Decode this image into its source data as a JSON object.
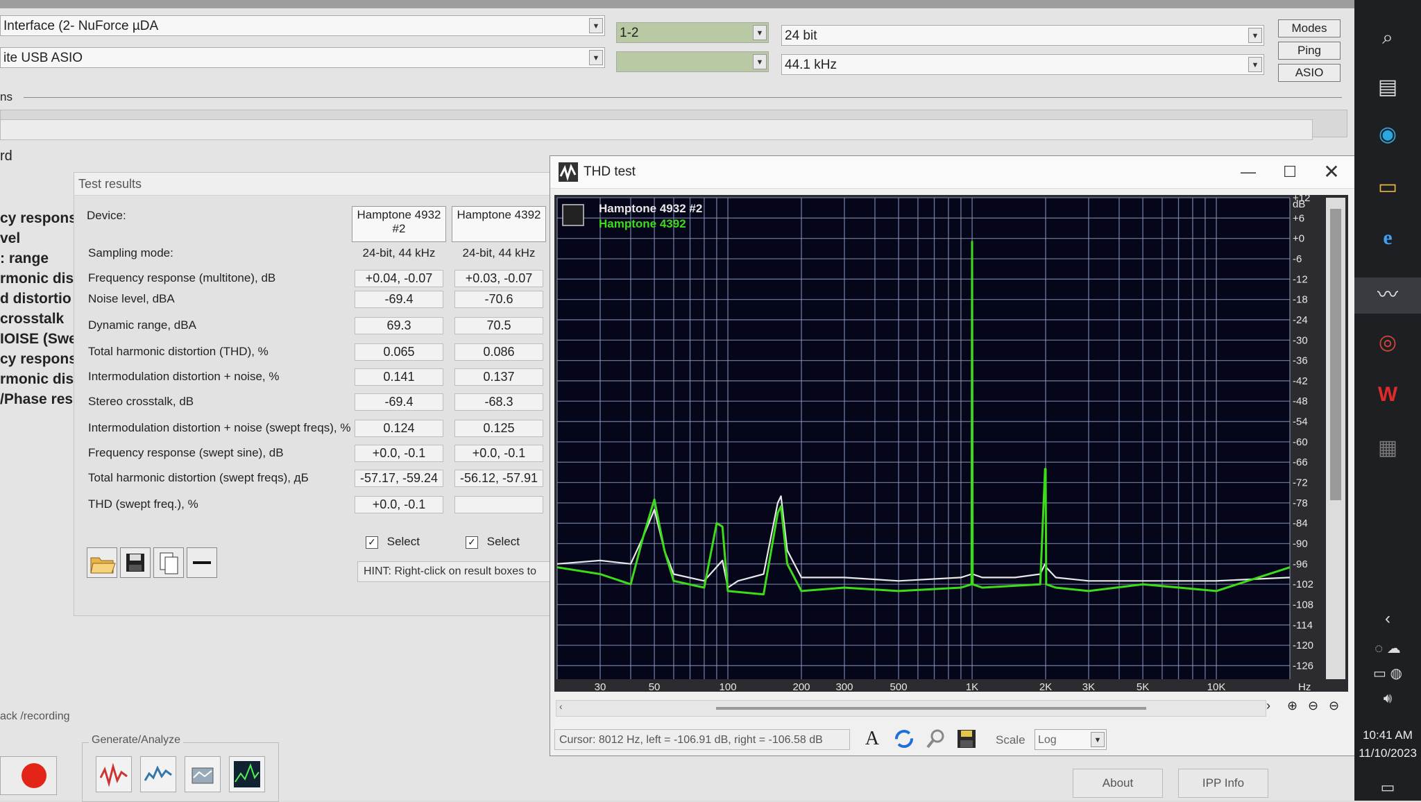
{
  "top": {
    "device1": "Interface (2- NuForce µDA",
    "device2": "ite USB ASIO",
    "channels1": "1-2",
    "channels2": "",
    "bits": "24 bit",
    "rate": "44.1 kHz",
    "modes_label": "Modes",
    "ping_label": "Ping",
    "asio_label": "ASIO",
    "section_label": "ns",
    "rd_label": "rd"
  },
  "left_list": [
    "cy respons",
    "vel",
    ": range",
    "rmonic dist",
    "d distortio",
    "crosstalk",
    "IOISE (Swe",
    "cy respons",
    "rmonic dist",
    "/Phase res"
  ],
  "bottom": {
    "playback_label": "ack /recording",
    "generate_label": "Generate/Analyze",
    "about_label": "About",
    "ipp_label": "IPP Info"
  },
  "test_results": {
    "title": "Test results",
    "device_label": "Device:",
    "device_a": "Hamptone 4932 #2",
    "device_b": "Hamptone 4392",
    "rows": [
      {
        "label": "Sampling mode:",
        "a": "24-bit, 44 kHz",
        "b": "24-bit, 44 kHz"
      },
      {
        "label": "Frequency response (multitone), dB",
        "a": "+0.04, -0.07",
        "b": "+0.03, -0.07"
      },
      {
        "label": "Noise level, dBA",
        "a": "-69.4",
        "b": "-70.6"
      },
      {
        "label": "Dynamic range, dBA",
        "a": "69.3",
        "b": "70.5"
      },
      {
        "label": "Total harmonic distortion (THD), %",
        "a": "0.065",
        "b": "0.086"
      },
      {
        "label": "Intermodulation distortion + noise, %",
        "a": "0.141",
        "b": "0.137"
      },
      {
        "label": "Stereo crosstalk, dB",
        "a": "-69.4",
        "b": "-68.3"
      },
      {
        "label": "Intermodulation distortion + noise (swept freqs), %",
        "a": "0.124",
        "b": "0.125"
      },
      {
        "label": "Frequency response (swept sine), dB",
        "a": "+0.0, -0.1",
        "b": "+0.0, -0.1"
      },
      {
        "label": "Total harmonic distortion (swept freqs), дБ",
        "a": "-57.17, -59.24",
        "b": "-56.12, -57.91"
      },
      {
        "label": "THD (swept freq.), %",
        "a": "+0.0, -0.1",
        "b": ""
      }
    ],
    "select_label": "Select",
    "hint": "HINT: Right-click on result boxes to"
  },
  "thd": {
    "title": "THD test",
    "legend": [
      {
        "name": "Hamptone 4932 #2",
        "color": "#ffffff"
      },
      {
        "name": "Hamptone 4392",
        "color": "#3ddc1a"
      }
    ],
    "cursor_text": "Cursor: 8012 Hz, left = -106.91 dB, right = -106.58 dB",
    "scale_label": "Scale",
    "scale_value": "Log"
  },
  "chart_data": {
    "type": "line",
    "title": "THD test",
    "xlabel": "Hz",
    "ylabel": "dB",
    "x_scale": "log",
    "xlim": [
      20,
      20000
    ],
    "ylim": [
      -130,
      12
    ],
    "x_ticks": [
      {
        "v": 30,
        "t": "30"
      },
      {
        "v": 50,
        "t": "50"
      },
      {
        "v": 100,
        "t": "100"
      },
      {
        "v": 200,
        "t": "200"
      },
      {
        "v": 300,
        "t": "300"
      },
      {
        "v": 500,
        "t": "500"
      },
      {
        "v": 1000,
        "t": "1K"
      },
      {
        "v": 2000,
        "t": "2K"
      },
      {
        "v": 3000,
        "t": "3K"
      },
      {
        "v": 5000,
        "t": "5K"
      },
      {
        "v": 10000,
        "t": "10K"
      }
    ],
    "y_ticks": [
      "+12",
      "+6",
      "+0",
      "-6",
      "-12",
      "-18",
      "-24",
      "-30",
      "-36",
      "-42",
      "-48",
      "-54",
      "-60",
      "-66",
      "-72",
      "-78",
      "-84",
      "-90",
      "-96",
      "-102",
      "-108",
      "-114",
      "-120",
      "-126"
    ],
    "grid": true,
    "series": [
      {
        "name": "Hamptone 4932 #2",
        "color": "#e8e8e8",
        "x": [
          20,
          30,
          40,
          45,
          50,
          55,
          60,
          80,
          95,
          100,
          110,
          140,
          160,
          165,
          175,
          200,
          300,
          500,
          900,
          995,
          1000,
          1005,
          1100,
          1500,
          1900,
          1990,
          2000,
          2010,
          2200,
          3000,
          5000,
          10000,
          20000
        ],
        "y": [
          -96,
          -95,
          -96,
          -88,
          -80,
          -92,
          -99,
          -101,
          -95,
          -103,
          -101,
          -99,
          -78,
          -76,
          -92,
          -100,
          -100,
          -101,
          -100,
          -99,
          -99,
          -99,
          -100,
          -100,
          -99,
          -96,
          -96,
          -97,
          -100,
          -101,
          -101,
          -101,
          -100
        ]
      },
      {
        "name": "Hamptone 4392",
        "color": "#3ddc1a",
        "x": [
          20,
          30,
          40,
          45,
          50,
          55,
          60,
          80,
          90,
          95,
          100,
          140,
          160,
          165,
          175,
          200,
          300,
          500,
          900,
          995,
          1000,
          1005,
          1100,
          1900,
          1990,
          2000,
          2010,
          2200,
          3000,
          5000,
          10000,
          20000
        ],
        "y": [
          -97,
          -99,
          -102,
          -88,
          -77,
          -92,
          -101,
          -103,
          -84,
          -85,
          -104,
          -105,
          -81,
          -79,
          -96,
          -104,
          -103,
          -104,
          -103,
          -102,
          -1,
          -102,
          -103,
          -102,
          -68,
          -68,
          -102,
          -103,
          -104,
          -102,
          -104,
          -97
        ]
      }
    ]
  }
}
